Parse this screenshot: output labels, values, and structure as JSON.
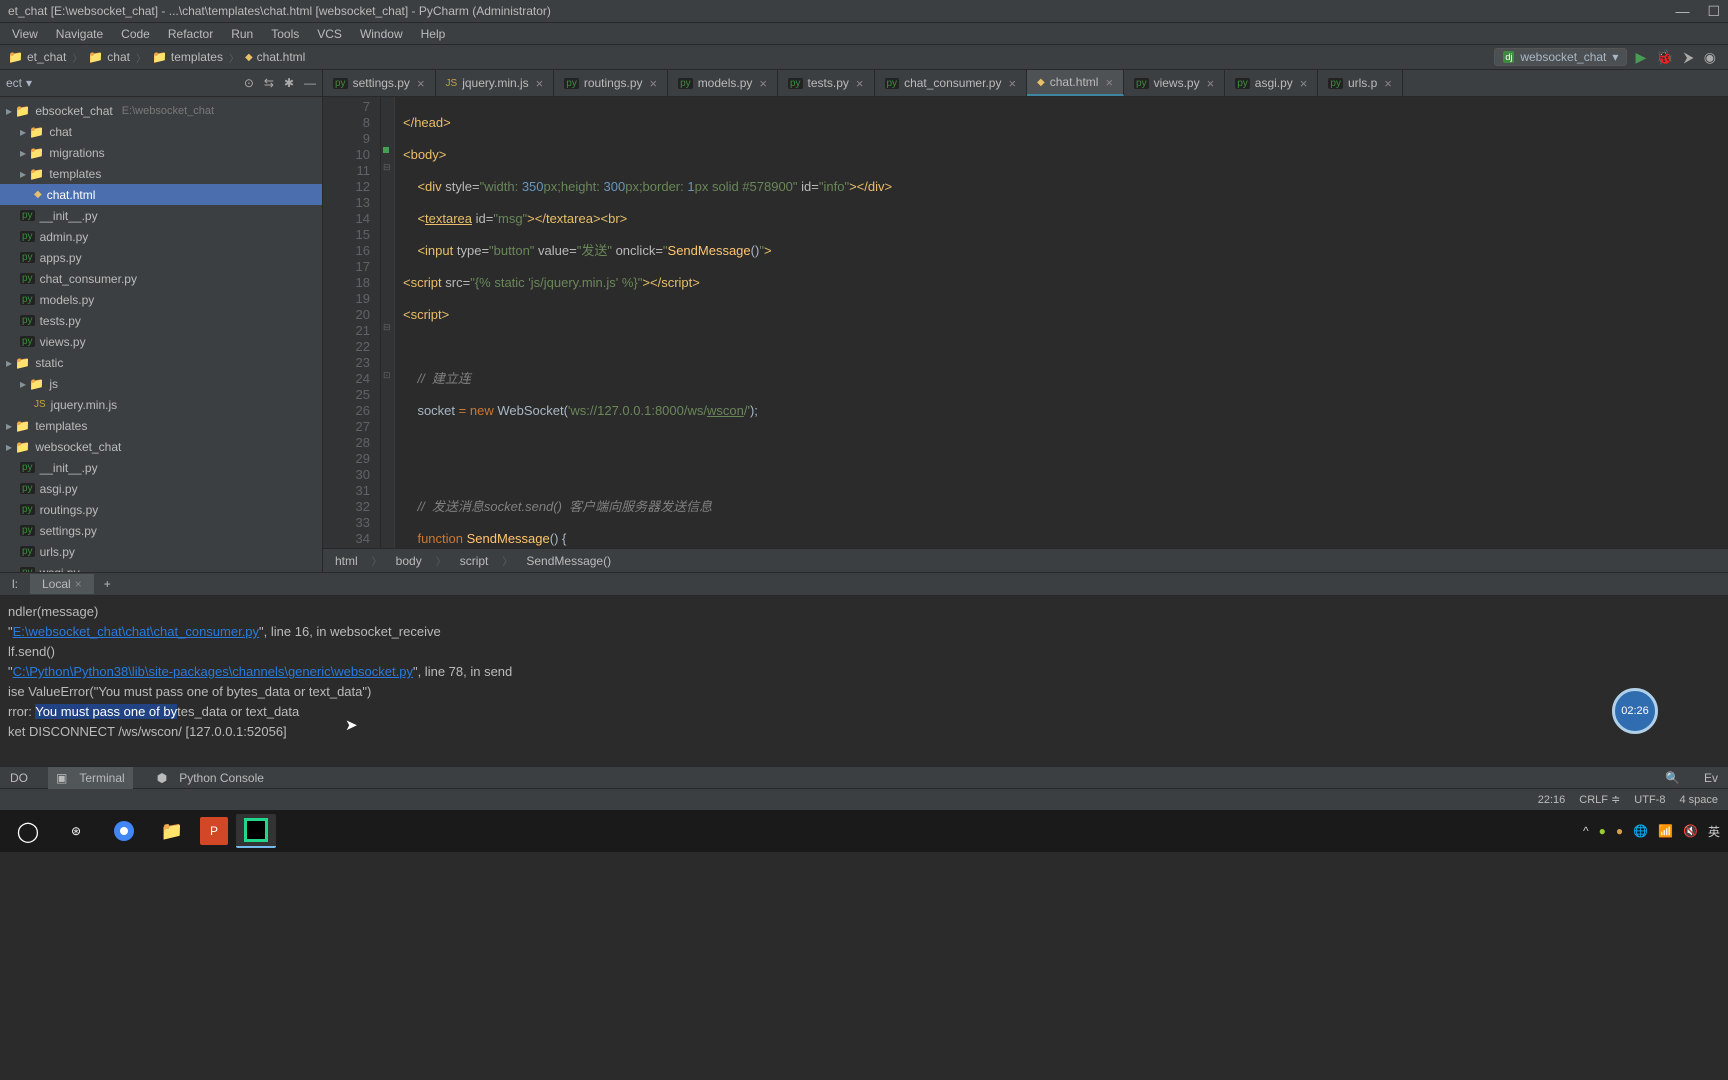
{
  "titleBar": {
    "text": "et_chat [E:\\websocket_chat] - ...\\chat\\templates\\chat.html [websocket_chat] - PyCharm (Administrator)"
  },
  "menu": [
    "View",
    "Navigate",
    "Code",
    "Refactor",
    "Run",
    "Tools",
    "VCS",
    "Window",
    "Help"
  ],
  "breadcrumbs": [
    "et_chat",
    "chat",
    "templates",
    "chat.html"
  ],
  "runConfig": "websocket_chat",
  "projectTree": [
    {
      "name": "ebsocket_chat",
      "path": "E:\\websocket_chat",
      "icon": "folder",
      "indent": 0
    },
    {
      "name": "chat",
      "icon": "folder",
      "indent": 1
    },
    {
      "name": "migrations",
      "icon": "folder",
      "indent": 1
    },
    {
      "name": "templates",
      "icon": "folder",
      "indent": 1
    },
    {
      "name": "chat.html",
      "icon": "html",
      "indent": 2,
      "selected": true
    },
    {
      "name": "__init__.py",
      "icon": "py",
      "indent": 1
    },
    {
      "name": "admin.py",
      "icon": "py",
      "indent": 1
    },
    {
      "name": "apps.py",
      "icon": "py",
      "indent": 1
    },
    {
      "name": "chat_consumer.py",
      "icon": "py",
      "indent": 1
    },
    {
      "name": "models.py",
      "icon": "py",
      "indent": 1
    },
    {
      "name": "tests.py",
      "icon": "py",
      "indent": 1
    },
    {
      "name": "views.py",
      "icon": "py",
      "indent": 1
    },
    {
      "name": "static",
      "icon": "folder",
      "indent": 0
    },
    {
      "name": "js",
      "icon": "folder",
      "indent": 1
    },
    {
      "name": "jquery.min.js",
      "icon": "js",
      "indent": 2
    },
    {
      "name": "templates",
      "icon": "folder",
      "indent": 0
    },
    {
      "name": "websocket_chat",
      "icon": "folder",
      "indent": 0
    },
    {
      "name": "__init__.py",
      "icon": "py",
      "indent": 1
    },
    {
      "name": "asgi.py",
      "icon": "py",
      "indent": 1
    },
    {
      "name": "routings.py",
      "icon": "py",
      "indent": 1
    },
    {
      "name": "settings.py",
      "icon": "py",
      "indent": 1
    },
    {
      "name": "urls.py",
      "icon": "py",
      "indent": 1
    },
    {
      "name": "wsgi.py",
      "icon": "py",
      "indent": 1
    }
  ],
  "editorTabs": [
    {
      "name": "settings.py",
      "icon": "py"
    },
    {
      "name": "jquery.min.js",
      "icon": "js"
    },
    {
      "name": "routings.py",
      "icon": "py"
    },
    {
      "name": "models.py",
      "icon": "py"
    },
    {
      "name": "tests.py",
      "icon": "py"
    },
    {
      "name": "chat_consumer.py",
      "icon": "py"
    },
    {
      "name": "chat.html",
      "icon": "html",
      "active": true
    },
    {
      "name": "views.py",
      "icon": "py"
    },
    {
      "name": "asgi.py",
      "icon": "py"
    },
    {
      "name": "urls.p",
      "icon": "py"
    }
  ],
  "gutterStart": 7,
  "gutterEnd": 34,
  "codeBreadcrumb": [
    "html",
    "body",
    "script",
    "SendMessage()"
  ],
  "terminalTab": "Local",
  "terminal": {
    "l1": "ndler(message)",
    "l2a": "  \"",
    "l2link": "E:\\websocket_chat\\chat\\chat_consumer.py",
    "l2b": "\", line 16, in websocket_receive",
    "l3": "lf.send()",
    "l4a": "  \"",
    "l4link": "C:\\Python\\Python38\\lib\\site-packages\\channels\\generic\\websocket.py",
    "l4b": "\", line 78, in send",
    "l5": "ise ValueError(\"You must pass one of bytes_data or text_data\")",
    "l6a": "rror: ",
    "l6sel": "You must pass one of by",
    "l6b": "tes_data or text_data",
    "l7": "ket DISCONNECT /ws/wscon/ [127.0.0.1:52056]"
  },
  "toolWindows": {
    "todo": "DO",
    "terminal": "Terminal",
    "python": "Python Console",
    "ev": "Ev"
  },
  "statusBar": {
    "time": "22:16",
    "sep": "CRLF",
    "enc": "UTF-8",
    "indent": "4 space"
  },
  "timer": "02:26",
  "tray": {
    "ime": "英"
  }
}
